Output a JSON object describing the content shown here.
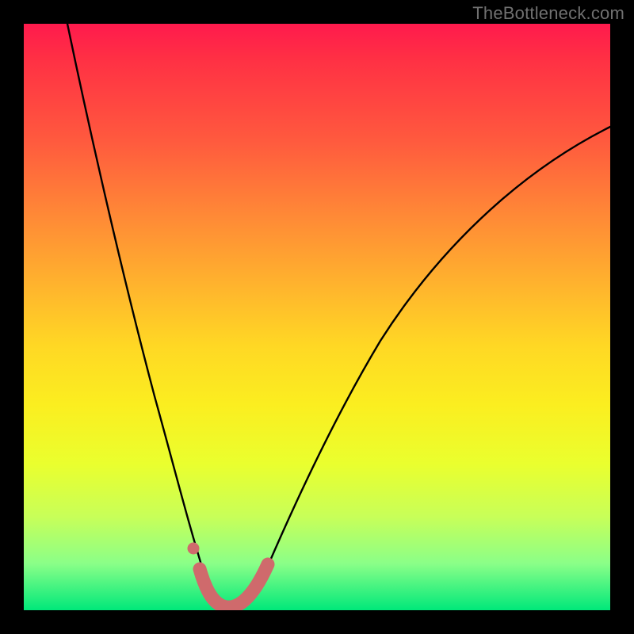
{
  "watermark": {
    "text": "TheBottleneck.com"
  },
  "colors": {
    "page_bg": "#000000",
    "curve_stroke": "#000000",
    "marker_stroke": "#cf6a6c",
    "marker_fill": "#cf6a6c",
    "gradient_stops": [
      "#ff1a4d",
      "#ff3044",
      "#ff5a3e",
      "#ff8a36",
      "#ffb52d",
      "#ffd824",
      "#fbee20",
      "#eaff2e",
      "#c8ff58",
      "#8bff88",
      "#00e87a"
    ]
  },
  "chart_data": {
    "type": "line",
    "title": "",
    "xlabel": "",
    "ylabel": "",
    "xlim": [
      0,
      100
    ],
    "ylim": [
      0,
      100
    ],
    "grid": false,
    "legend": false,
    "annotations": [],
    "series": [
      {
        "name": "bottleneck-curve",
        "x": [
          3,
          5,
          8,
          12,
          16,
          20,
          24,
          27,
          29,
          30,
          31,
          33,
          35,
          37,
          40,
          45,
          52,
          60,
          70,
          80,
          90,
          100
        ],
        "values": [
          100,
          90,
          78,
          63,
          48,
          34,
          21,
          12,
          6,
          3,
          1,
          1,
          3,
          7,
          13,
          24,
          38,
          51,
          63,
          72,
          78,
          82
        ]
      }
    ],
    "markers": {
      "name": "highlight-band",
      "x": [
        27,
        29,
        30,
        31,
        33,
        35,
        37
      ],
      "values": [
        12,
        6,
        3,
        1,
        1,
        3,
        7
      ]
    }
  }
}
